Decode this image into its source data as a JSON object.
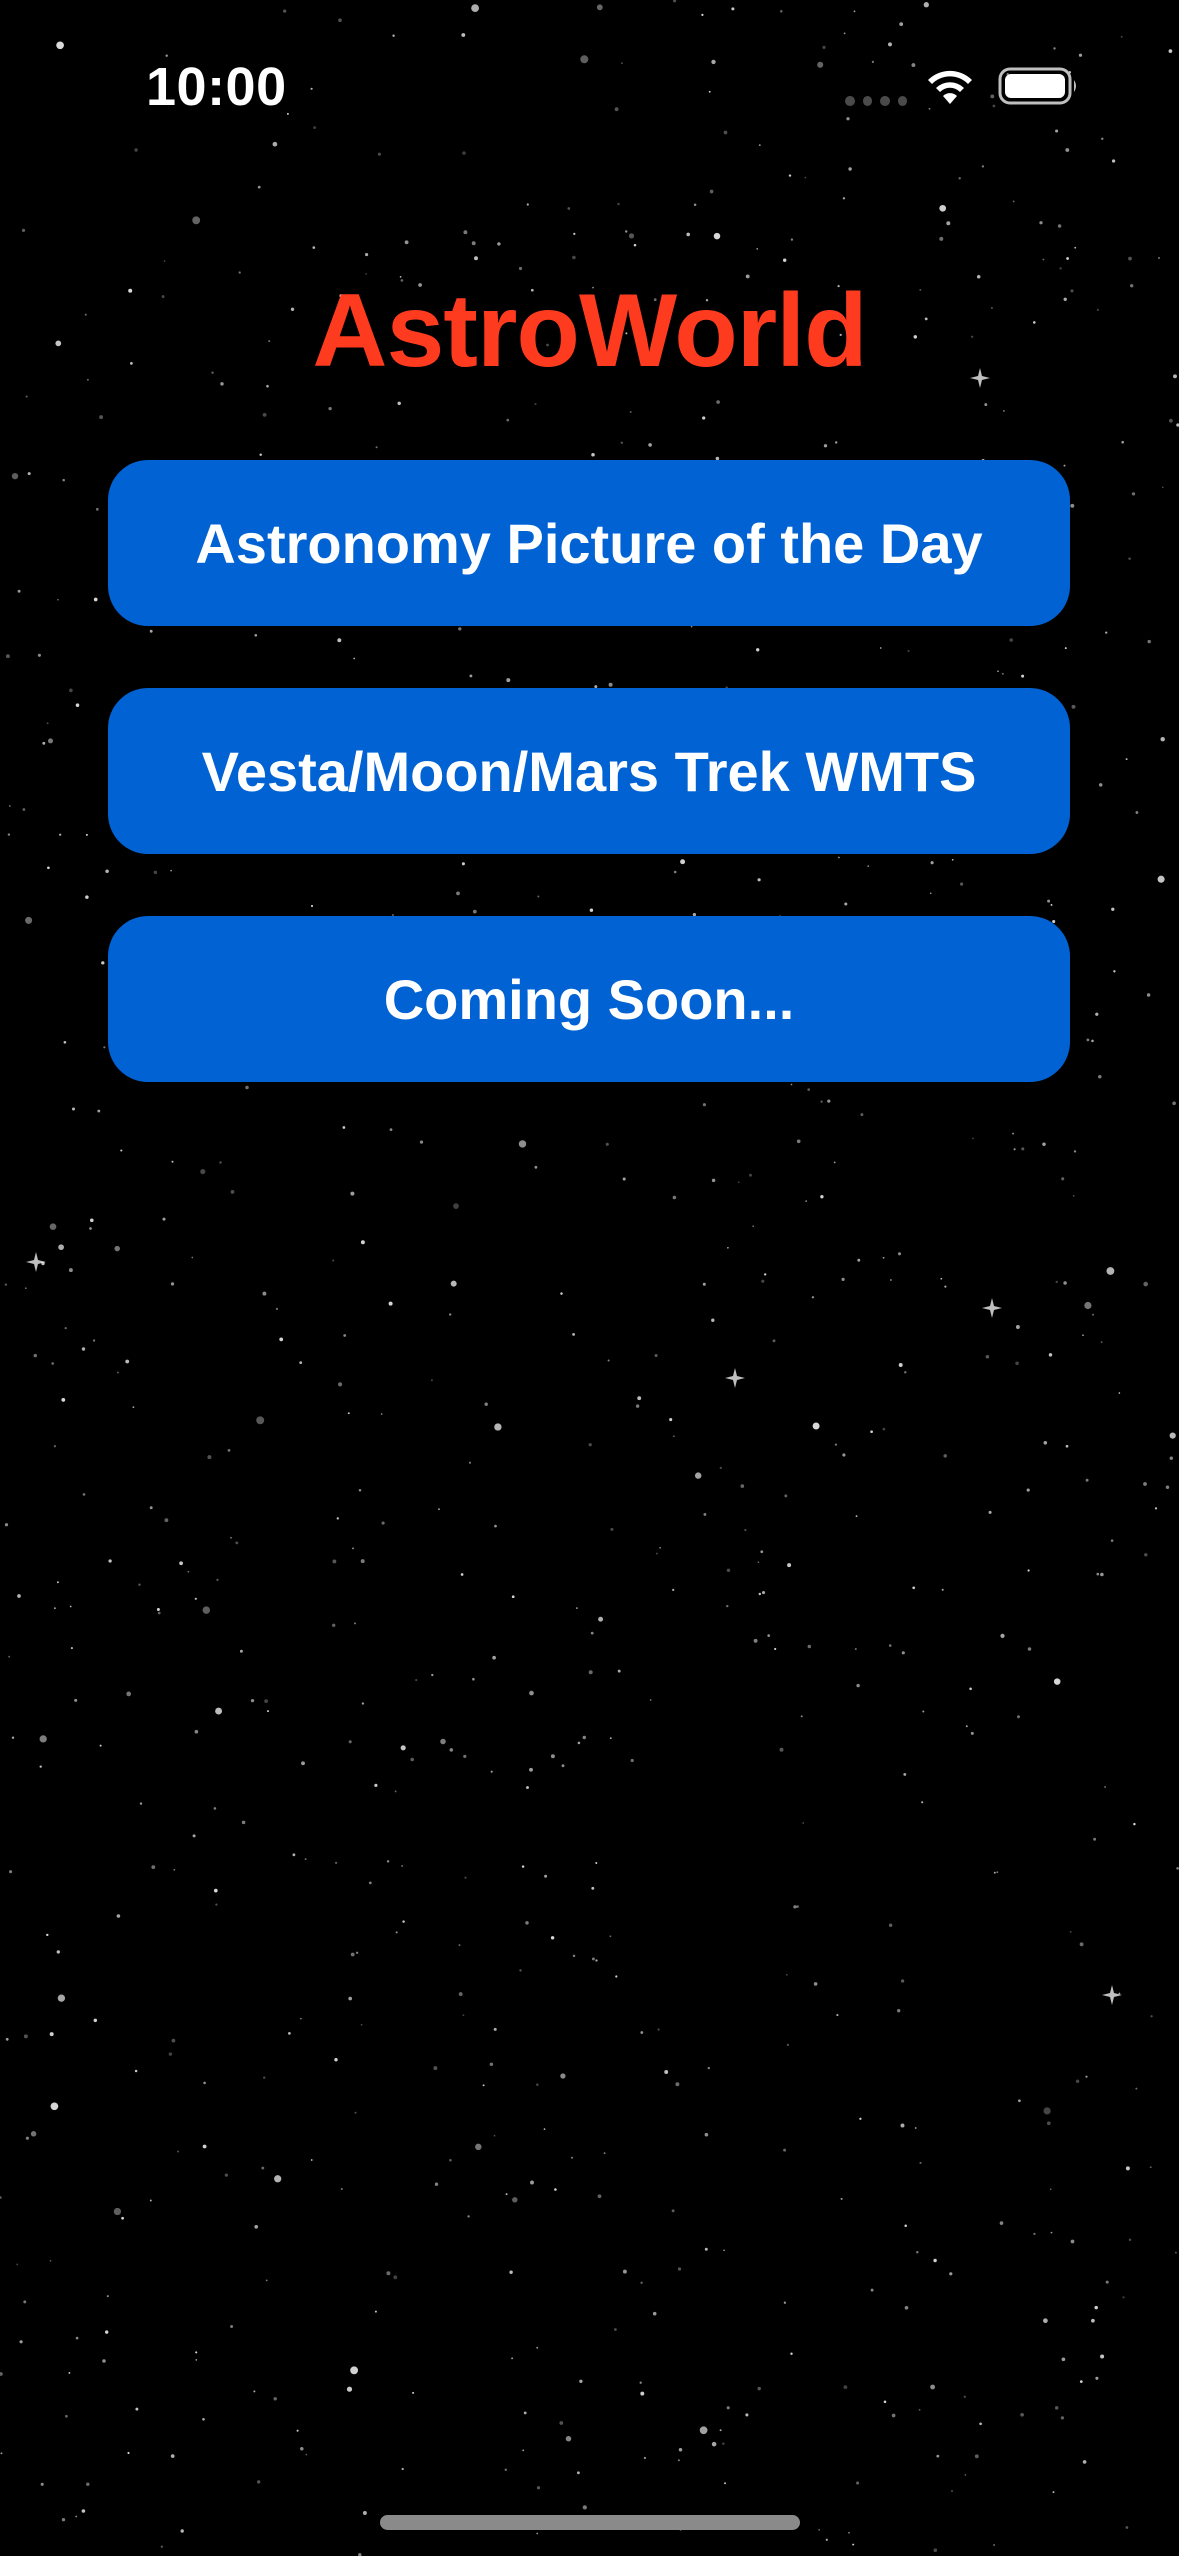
{
  "status_bar": {
    "time": "10:00"
  },
  "app": {
    "title": "AstroWorld"
  },
  "menu": {
    "items": [
      {
        "label": "Astronomy Picture of the Day"
      },
      {
        "label": "Vesta/Moon/Mars Trek WMTS"
      },
      {
        "label": "Coming Soon..."
      }
    ]
  },
  "colors": {
    "background": "#000000",
    "title": "#ff3b1f",
    "button": "#0062d3",
    "button_text": "#ffffff"
  },
  "icons": {
    "signal": "cellular-signal-icon",
    "wifi": "wifi-icon",
    "battery": "battery-icon"
  }
}
